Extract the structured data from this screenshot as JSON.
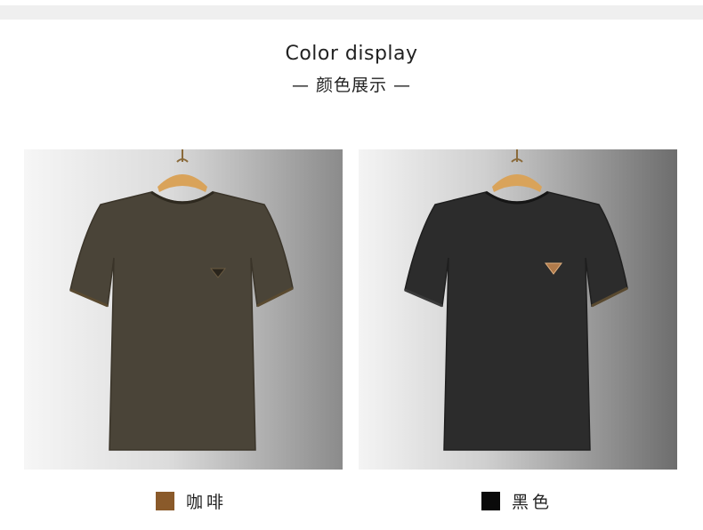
{
  "header": {
    "title_en": "Color display",
    "title_cn": "— 颜色展示 —"
  },
  "colors": [
    {
      "label": "咖啡",
      "swatch": "#8a5a2a",
      "shirt": "#4a4438",
      "shirt_dark": "#3a3429"
    },
    {
      "label": "黑色",
      "swatch": "#0a0a0a",
      "shirt": "#2c2c2c",
      "shirt_dark": "#1e1e1e"
    }
  ],
  "icons": [
    "hanger-icon",
    "logo-badge-icon"
  ]
}
